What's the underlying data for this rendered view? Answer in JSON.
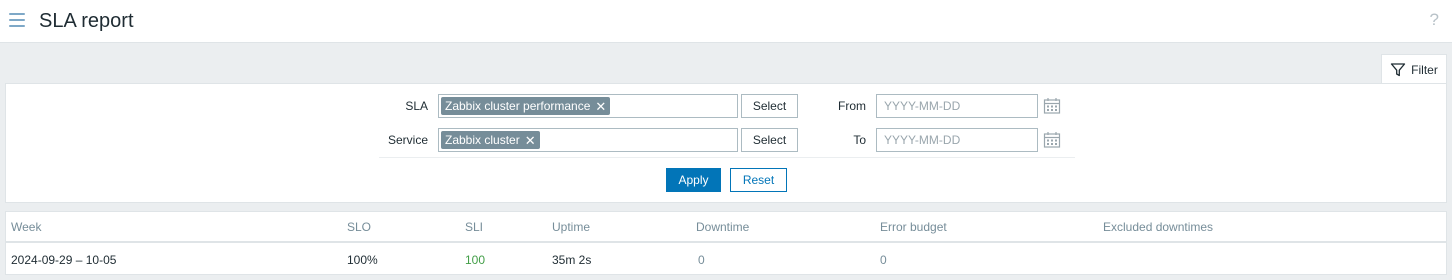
{
  "header": {
    "title": "SLA report",
    "help_glyph": "?"
  },
  "filter": {
    "tab_label": "Filter",
    "sla_label": "SLA",
    "sla_tags": [
      "Zabbix cluster performance"
    ],
    "service_label": "Service",
    "service_tags": [
      "Zabbix cluster"
    ],
    "select_label": "Select",
    "from_label": "From",
    "to_label": "To",
    "from_value": "",
    "to_value": "",
    "date_placeholder": "YYYY-MM-DD",
    "apply_label": "Apply",
    "reset_label": "Reset"
  },
  "table": {
    "columns": [
      "Week",
      "SLO",
      "SLI",
      "Uptime",
      "Downtime",
      "Error budget",
      "Excluded downtimes"
    ],
    "rows": [
      {
        "week": "2024-09-29 – 10-05",
        "slo": "100%",
        "sli": "100",
        "uptime": "35m 2s",
        "downtime": "0",
        "error_budget": "0",
        "excluded_downtimes": ""
      }
    ]
  },
  "colors": {
    "primary": "#0275b8",
    "sli_ok": "#429e47",
    "muted": "#768d99",
    "tag_bg": "#768d99"
  },
  "icons": {
    "menu": "hamburger-icon",
    "help": "question-icon",
    "filter": "funnel-icon",
    "calendar": "calendar-icon",
    "remove": "close-icon"
  }
}
